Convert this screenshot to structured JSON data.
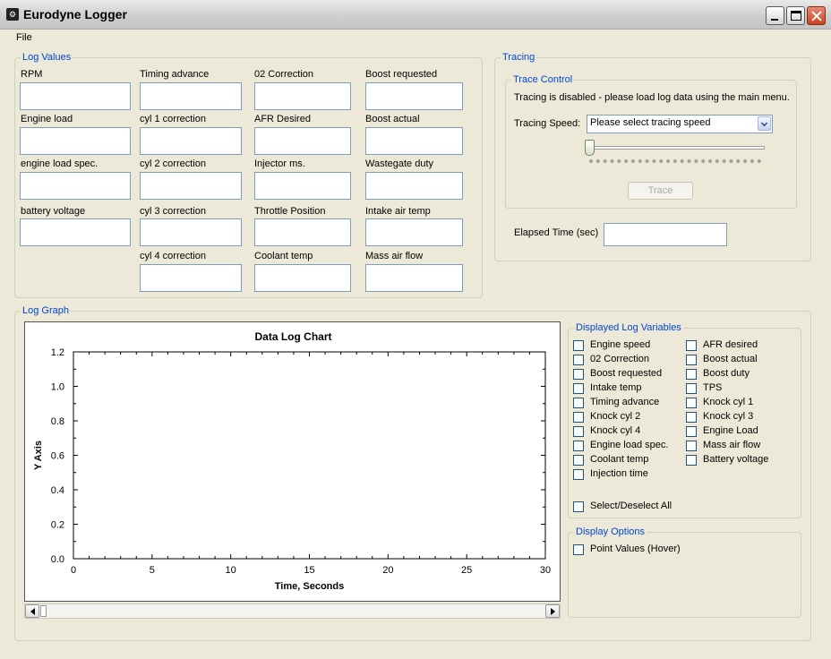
{
  "window": {
    "title": "Eurodyne Logger"
  },
  "menu": {
    "items": [
      "File"
    ]
  },
  "log_values": {
    "label": "Log Values",
    "fields": [
      "RPM",
      "Timing advance",
      "02 Correction",
      "Boost requested",
      "Engine load",
      "cyl 1 correction",
      "AFR Desired",
      "Boost actual",
      "engine load spec.",
      "cyl 2 correction",
      "Injector ms.",
      "Wastegate duty",
      " battery voltage",
      "cyl 3 correction",
      "Throttle Position",
      "Intake air temp",
      "cyl 4 correction",
      "Coolant temp",
      "Mass air flow"
    ]
  },
  "tracing": {
    "label": "Tracing",
    "control_label": "Trace Control",
    "status": "Tracing is disabled - please load log data using the main menu.",
    "speed_label": "Tracing Speed:",
    "speed_value": "Please select tracing speed",
    "trace_button": "Trace",
    "elapsed_label": "Elapsed Time (sec)",
    "elapsed_value": ""
  },
  "log_graph": {
    "label": "Log Graph"
  },
  "chart_data": {
    "type": "line",
    "title": "Data Log Chart",
    "xlabel": "Time, Seconds",
    "ylabel": "Y Axis",
    "xlim": [
      0,
      30
    ],
    "ylim": [
      0,
      1.2
    ],
    "x_ticks": [
      "0",
      "5",
      "10",
      "15",
      "20",
      "25",
      "30"
    ],
    "y_ticks": [
      "0.0",
      "0.2",
      "0.4",
      "0.6",
      "0.8",
      "1.0",
      "1.2"
    ],
    "series": [],
    "grid": false
  },
  "displayed_vars": {
    "label": "Displayed Log Variables",
    "left": [
      "Engine speed",
      "02 Correction",
      "Boost requested",
      "Intake temp",
      "Timing advance",
      "Knock cyl 2",
      "Knock cyl 4",
      "Engine load spec.",
      "Coolant temp",
      "Injection time"
    ],
    "right": [
      "AFR desired",
      "Boost actual",
      "Boost duty",
      "TPS",
      "Knock cyl 1",
      "Knock cyl 3",
      "Engine Load",
      "Mass air flow",
      "Battery voltage"
    ],
    "select_all": "Select/Deselect All"
  },
  "display_options": {
    "label": "Display Options",
    "point_values": "Point Values (Hover)"
  }
}
